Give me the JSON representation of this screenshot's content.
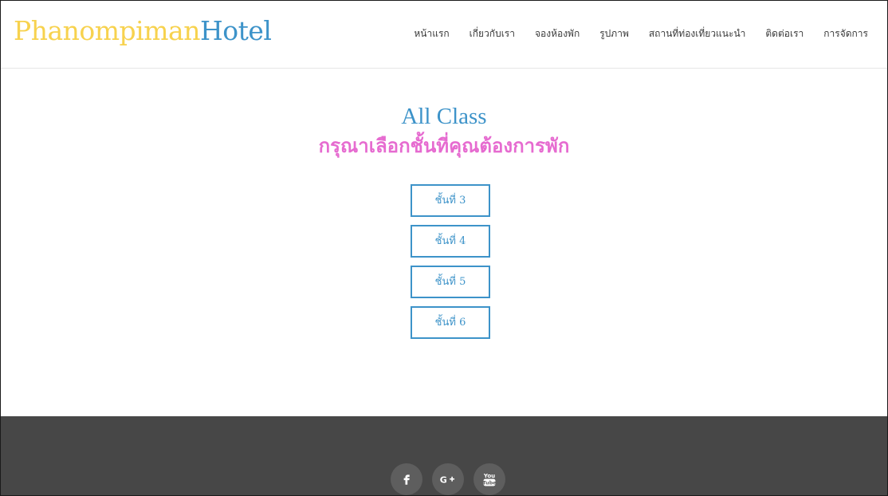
{
  "header": {
    "brand_part1": "Phanompiman",
    "brand_part2": "Hotel",
    "brand_colors": {
      "part1": "#f7d24e",
      "part2": "#3d93c9"
    },
    "nav": [
      {
        "label": "หน้าแรก"
      },
      {
        "label": "เกี่ยวกับเรา"
      },
      {
        "label": "จองห้องพัก"
      },
      {
        "label": "รูปภาพ"
      },
      {
        "label": "สถานที่ท่องเที่ยวแนะนำ"
      },
      {
        "label": "ติดต่อเรา"
      },
      {
        "label": "การจัดการ"
      }
    ]
  },
  "main": {
    "title": "All Class",
    "subtitle": "กรุณาเลือกชั้นที่คุณต้องการพัก",
    "floors": [
      {
        "label": "ชั้นที่ 3"
      },
      {
        "label": "ชั้นที่ 4"
      },
      {
        "label": "ชั้นที่ 5"
      },
      {
        "label": "ชั้นที่ 6"
      }
    ],
    "accent_color": "#3d93c9",
    "subtitle_color": "#e66bd0"
  },
  "footer": {
    "background": "#474747",
    "social": [
      {
        "icon": "facebook-icon"
      },
      {
        "icon": "google-plus-icon"
      },
      {
        "icon": "youtube-icon"
      }
    ]
  }
}
